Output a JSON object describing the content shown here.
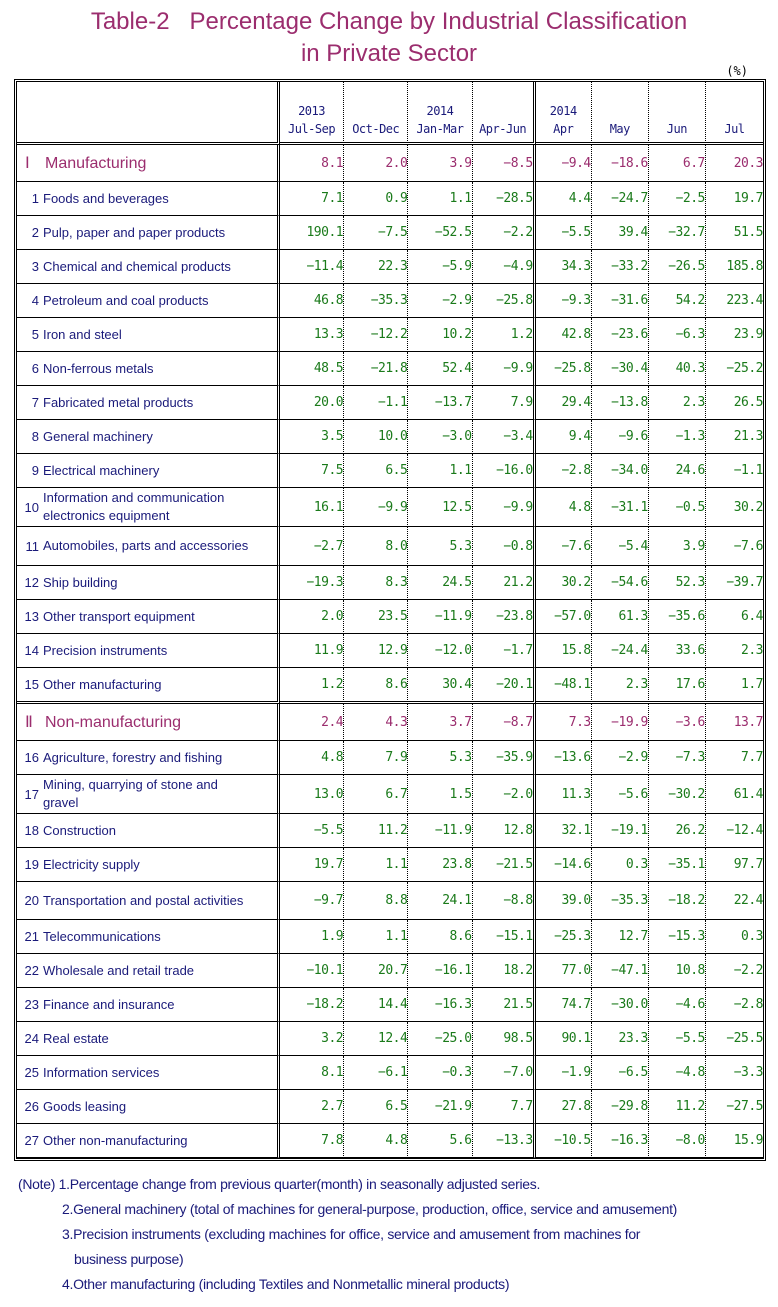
{
  "title_line1": "Table-2   Percentage Change by Industrial Classification",
  "title_line2": "in Private Sector",
  "unit": "(%)",
  "header": {
    "quarters_year_2013": "2013",
    "quarters_year_2014": "2014",
    "months_year": "2014",
    "columns": [
      "Jul-Sep",
      "Oct-Dec",
      "Jan-Mar",
      "Apr-Jun",
      "Apr",
      "May",
      "Jun",
      "Jul"
    ]
  },
  "colors": {
    "title": "#9b2d6e",
    "label": "#1a1a7a",
    "value": "#1a7a1a",
    "section_value": "#9b2d6e"
  },
  "rows": [
    {
      "type": "section",
      "num": "Ⅰ",
      "label": "Manufacturing",
      "values": [
        "8.1",
        "2.0",
        "3.9",
        "−8.5",
        "−9.4",
        "−18.6",
        "6.7",
        "20.3"
      ]
    },
    {
      "num": "1",
      "label": "Foods and beverages",
      "values": [
        "7.1",
        "0.9",
        "1.1",
        "−28.5",
        "4.4",
        "−24.7",
        "−2.5",
        "19.7"
      ]
    },
    {
      "num": "2",
      "label": "Pulp, paper and paper products",
      "values": [
        "190.1",
        "−7.5",
        "−52.5",
        "−2.2",
        "−5.5",
        "39.4",
        "−32.7",
        "51.5"
      ]
    },
    {
      "num": "3",
      "label": "Chemical and chemical products",
      "values": [
        "−11.4",
        "22.3",
        "−5.9",
        "−4.9",
        "34.3",
        "−33.2",
        "−26.5",
        "185.8"
      ]
    },
    {
      "num": "4",
      "label": "Petroleum and coal products",
      "values": [
        "46.8",
        "−35.3",
        "−2.9",
        "−25.8",
        "−9.3",
        "−31.6",
        "54.2",
        "223.4"
      ]
    },
    {
      "num": "5",
      "label": "Iron and steel",
      "values": [
        "13.3",
        "−12.2",
        "10.2",
        "1.2",
        "42.8",
        "−23.6",
        "−6.3",
        "23.9"
      ]
    },
    {
      "num": "6",
      "label": "Non-ferrous metals",
      "values": [
        "48.5",
        "−21.8",
        "52.4",
        "−9.9",
        "−25.8",
        "−30.4",
        "40.3",
        "−25.2"
      ]
    },
    {
      "num": "7",
      "label": "Fabricated metal products",
      "values": [
        "20.0",
        "−1.1",
        "−13.7",
        "7.9",
        "29.4",
        "−13.8",
        "2.3",
        "26.5"
      ]
    },
    {
      "num": "8",
      "label": "General machinery",
      "values": [
        "3.5",
        "10.0",
        "−3.0",
        "−3.4",
        "9.4",
        "−9.6",
        "−1.3",
        "21.3"
      ]
    },
    {
      "num": "9",
      "label": "Electrical machinery",
      "values": [
        "7.5",
        "6.5",
        "1.1",
        "−16.0",
        "−2.8",
        "−34.0",
        "24.6",
        "−1.1"
      ]
    },
    {
      "num": "10",
      "label": "Information and communication electronics equipment",
      "tall": true,
      "values": [
        "16.1",
        "−9.9",
        "12.5",
        "−9.9",
        "4.8",
        "−31.1",
        "−0.5",
        "30.2"
      ]
    },
    {
      "num": "11",
      "label": "Automobiles, parts and accessories",
      "tall": true,
      "values": [
        "−2.7",
        "8.0",
        "5.3",
        "−0.8",
        "−7.6",
        "−5.4",
        "3.9",
        "−7.6"
      ]
    },
    {
      "num": "12",
      "label": "Ship building",
      "values": [
        "−19.3",
        "8.3",
        "24.5",
        "21.2",
        "30.2",
        "−54.6",
        "52.3",
        "−39.7"
      ]
    },
    {
      "num": "13",
      "label": "Other transport equipment",
      "values": [
        "2.0",
        "23.5",
        "−11.9",
        "−23.8",
        "−57.0",
        "61.3",
        "−35.6",
        "6.4"
      ]
    },
    {
      "num": "14",
      "label": "Precision instruments",
      "values": [
        "11.9",
        "12.9",
        "−12.0",
        "−1.7",
        "15.8",
        "−24.4",
        "33.6",
        "2.3"
      ]
    },
    {
      "num": "15",
      "label": "Other manufacturing",
      "sep": true,
      "values": [
        "1.2",
        "8.6",
        "30.4",
        "−20.1",
        "−48.1",
        "2.3",
        "17.6",
        "1.7"
      ]
    },
    {
      "type": "section",
      "num": "Ⅱ",
      "label": "Non-manufacturing",
      "values": [
        "2.4",
        "4.3",
        "3.7",
        "−8.7",
        "7.3",
        "−19.9",
        "−3.6",
        "13.7"
      ]
    },
    {
      "num": "16",
      "label": "Agriculture, forestry and fishing",
      "values": [
        "4.8",
        "7.9",
        "5.3",
        "−35.9",
        "−13.6",
        "−2.9",
        "−7.3",
        "7.7"
      ]
    },
    {
      "num": "17",
      "label": "Mining, quarrying of stone and gravel",
      "tall": true,
      "values": [
        "13.0",
        "6.7",
        "1.5",
        "−2.0",
        "11.3",
        "−5.6",
        "−30.2",
        "61.4"
      ]
    },
    {
      "num": "18",
      "label": "Construction",
      "values": [
        "−5.5",
        "11.2",
        "−11.9",
        "12.8",
        "32.1",
        "−19.1",
        "26.2",
        "−12.4"
      ]
    },
    {
      "num": "19",
      "label": "Electricity supply",
      "values": [
        "19.7",
        "1.1",
        "23.8",
        "−21.5",
        "−14.6",
        "0.3",
        "−35.1",
        "97.7"
      ]
    },
    {
      "num": "20",
      "label": "Transportation and postal activities",
      "tall2": true,
      "values": [
        "−9.7",
        "8.8",
        "24.1",
        "−8.8",
        "39.0",
        "−35.3",
        "−18.2",
        "22.4"
      ]
    },
    {
      "num": "21",
      "label": "Telecommunications",
      "values": [
        "1.9",
        "1.1",
        "8.6",
        "−15.1",
        "−25.3",
        "12.7",
        "−15.3",
        "0.3"
      ]
    },
    {
      "num": "22",
      "label": "Wholesale and retail trade",
      "values": [
        "−10.1",
        "20.7",
        "−16.1",
        "18.2",
        "77.0",
        "−47.1",
        "10.8",
        "−2.2"
      ]
    },
    {
      "num": "23",
      "label": "Finance and insurance",
      "values": [
        "−18.2",
        "14.4",
        "−16.3",
        "21.5",
        "74.7",
        "−30.0",
        "−4.6",
        "−2.8"
      ]
    },
    {
      "num": "24",
      "label": "Real estate",
      "values": [
        "3.2",
        "12.4",
        "−25.0",
        "98.5",
        "90.1",
        "23.3",
        "−5.5",
        "−25.5"
      ]
    },
    {
      "num": "25",
      "label": "Information services",
      "values": [
        "8.1",
        "−6.1",
        "−0.3",
        "−7.0",
        "−1.9",
        "−6.5",
        "−4.8",
        "−3.3"
      ]
    },
    {
      "num": "26",
      "label": "Goods leasing",
      "values": [
        "2.7",
        "6.5",
        "−21.9",
        "7.7",
        "27.8",
        "−29.8",
        "11.2",
        "−27.5"
      ]
    },
    {
      "num": "27",
      "label": "Other non-manufacturing",
      "values": [
        "7.8",
        "4.8",
        "5.6",
        "−13.3",
        "−10.5",
        "−16.3",
        "−8.0",
        "15.9"
      ]
    }
  ],
  "notes": [
    "(Note) 1.Percentage change from previous quarter(month) in seasonally adjusted series.",
    "2.General machinery (total of machines for general-purpose, production, office, service and amusement)",
    "3.Precision instruments (excluding machines for office, service and amusement from machines for",
    "business purpose)",
    "4.Other manufacturing (including Textiles and Nonmetallic mineral products)"
  ]
}
